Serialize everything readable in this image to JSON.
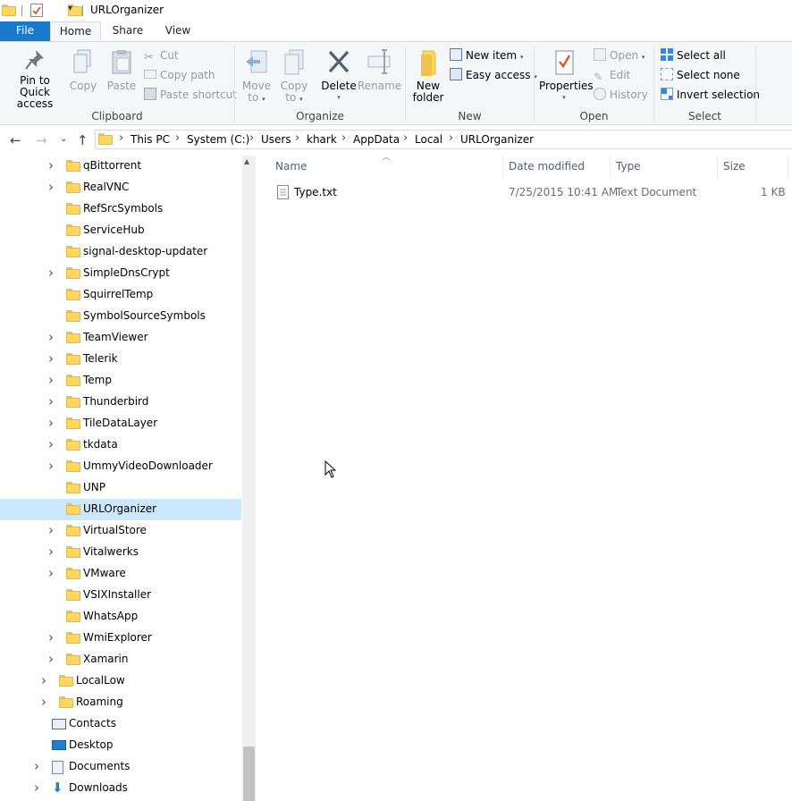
{
  "window": {
    "title": "URLOrganizer"
  },
  "tabs": {
    "file": "File",
    "home": "Home",
    "share": "Share",
    "view": "View"
  },
  "ribbon": {
    "clipboard": {
      "label": "Clipboard",
      "pin_line1": "Pin to Quick",
      "pin_line2": "access",
      "copy": "Copy",
      "paste": "Paste",
      "cut": "Cut",
      "copy_path": "Copy path",
      "paste_shortcut": "Paste shortcut"
    },
    "organize": {
      "label": "Organize",
      "move_line1": "Move",
      "move_line2": "to",
      "copy_line1": "Copy",
      "copy_line2": "to",
      "delete": "Delete",
      "rename": "Rename"
    },
    "new": {
      "label": "New",
      "new_folder_line1": "New",
      "new_folder_line2": "folder",
      "new_item": "New item",
      "easy_access": "Easy access"
    },
    "open": {
      "label": "Open",
      "properties": "Properties",
      "open": "Open",
      "edit": "Edit",
      "history": "History"
    },
    "select": {
      "label": "Select",
      "select_all": "Select all",
      "select_none": "Select none",
      "invert_selection": "Invert selection"
    }
  },
  "breadcrumb": [
    "This PC",
    "System (C:)",
    "Users",
    "khark",
    "AppData",
    "Local",
    "URLOrganizer"
  ],
  "nav_tree": [
    {
      "label": "qBittorrent",
      "expandable": true
    },
    {
      "label": "RealVNC",
      "expandable": true
    },
    {
      "label": "RefSrcSymbols",
      "expandable": false
    },
    {
      "label": "ServiceHub",
      "expandable": false
    },
    {
      "label": "signal-desktop-updater",
      "expandable": false
    },
    {
      "label": "SimpleDnsCrypt",
      "expandable": true
    },
    {
      "label": "SquirrelTemp",
      "expandable": false
    },
    {
      "label": "SymbolSourceSymbols",
      "expandable": false
    },
    {
      "label": "TeamViewer",
      "expandable": true
    },
    {
      "label": "Telerik",
      "expandable": true
    },
    {
      "label": "Temp",
      "expandable": true
    },
    {
      "label": "Thunderbird",
      "expandable": true
    },
    {
      "label": "TileDataLayer",
      "expandable": true
    },
    {
      "label": "tkdata",
      "expandable": true
    },
    {
      "label": "UmmyVideoDownloader",
      "expandable": true
    },
    {
      "label": "UNP",
      "expandable": false
    },
    {
      "label": "URLOrganizer",
      "expandable": false,
      "selected": true
    },
    {
      "label": "VirtualStore",
      "expandable": true
    },
    {
      "label": "Vitalwerks",
      "expandable": true
    },
    {
      "label": "VMware",
      "expandable": true
    },
    {
      "label": "VSIXInstaller",
      "expandable": false
    },
    {
      "label": "WhatsApp",
      "expandable": false
    },
    {
      "label": "WmiExplorer",
      "expandable": true
    },
    {
      "label": "Xamarin",
      "expandable": true
    },
    {
      "label": "LocalLow",
      "expandable": true
    },
    {
      "label": "Roaming",
      "expandable": true
    },
    {
      "label": "Contacts",
      "expandable": false
    },
    {
      "label": "Desktop",
      "expandable": false
    },
    {
      "label": "Documents",
      "expandable": true
    },
    {
      "label": "Downloads",
      "expandable": true
    }
  ],
  "columns": {
    "name": "Name",
    "date_modified": "Date modified",
    "type": "Type",
    "size": "Size"
  },
  "files": [
    {
      "name": "Type.txt",
      "date_modified": "7/25/2015 10:41 AM",
      "type": "Text Document",
      "size": "1 KB"
    }
  ],
  "colors": {
    "accent": "#1979ca",
    "selection": "#cce8ff",
    "folder": "#ffd75c"
  }
}
